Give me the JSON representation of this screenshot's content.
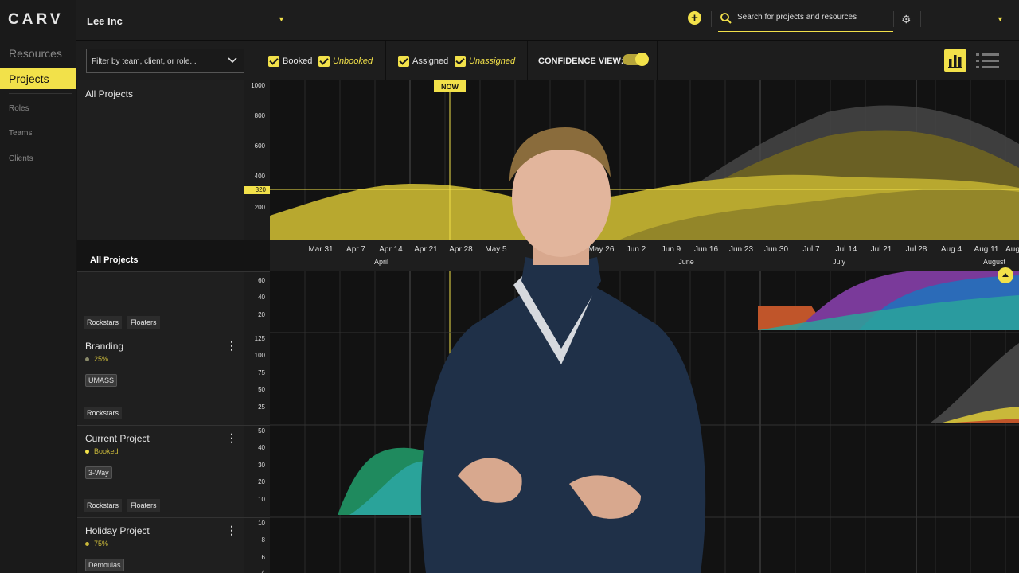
{
  "app": {
    "logo": "CARV"
  },
  "nav": {
    "resources": "Resources",
    "projects": "Projects",
    "sub": [
      "Roles",
      "Teams",
      "Clients"
    ]
  },
  "header": {
    "company": "Lee Inc",
    "search_placeholder": "Search for projects and resources"
  },
  "filters": {
    "filter_placeholder": "Filter by team, client, or role...",
    "booked": "Booked",
    "unbooked": "Unbooked",
    "assigned": "Assigned",
    "unassigned": "Unassigned",
    "confidence_label": "CONFIDENCE VIEW:",
    "confidence_on": true
  },
  "overview": {
    "title": "All Projects",
    "now_label": "NOW",
    "now_value": "320",
    "yticks": [
      "1000",
      "800",
      "600",
      "400",
      "200"
    ]
  },
  "timeline": {
    "section_label": "All Projects",
    "dates": [
      "Mar 31",
      "Apr 7",
      "Apr 14",
      "Apr 21",
      "Apr 28",
      "May 5",
      "May 26",
      "Jun 2",
      "Jun 9",
      "Jun 16",
      "Jun 23",
      "Jun 30",
      "Jul 7",
      "Jul 14",
      "Jul 21",
      "Jul 28",
      "Aug 4",
      "Aug 11",
      "Aug"
    ],
    "months": [
      "April",
      "June",
      "July",
      "August"
    ]
  },
  "projects": [
    {
      "name": "",
      "yticks": [
        "60",
        "40",
        "20"
      ],
      "tags": [
        "Rockstars",
        "Floaters"
      ]
    },
    {
      "name": "Branding",
      "status": "25%",
      "client": "UMASS",
      "yticks": [
        "125",
        "100",
        "75",
        "50",
        "25"
      ],
      "tags": [
        "Rockstars"
      ]
    },
    {
      "name": "Current Project",
      "status": "Booked",
      "client": "3-Way",
      "yticks": [
        "50",
        "40",
        "30",
        "20",
        "10"
      ],
      "tags": [
        "Rockstars",
        "Floaters"
      ]
    },
    {
      "name": "Holiday Project",
      "status": "75%",
      "client": "Demoulas",
      "yticks": [
        "10",
        "8",
        "6",
        "4"
      ],
      "tags": []
    }
  ],
  "colors": {
    "accent": "#f2e14a",
    "background": "#121212",
    "panel": "#1d1d1d"
  }
}
